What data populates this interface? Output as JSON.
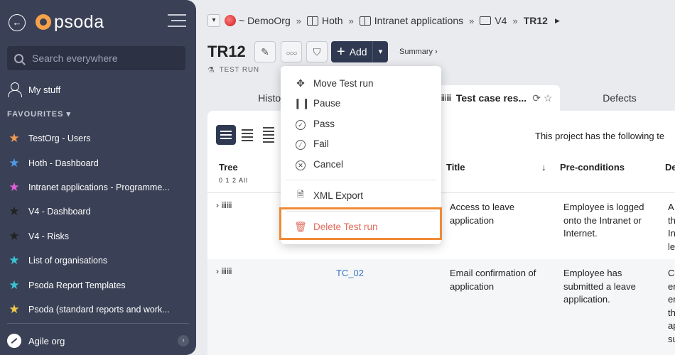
{
  "sidebar": {
    "logo_text": "psoda",
    "search_placeholder": "Search everywhere",
    "my_stuff": "My stuff",
    "favourites_heading": "FAVOURITES",
    "favourites": [
      {
        "label": "TestOrg - Users",
        "color": "#f39a4f"
      },
      {
        "label": "Hoth - Dashboard",
        "color": "#4f9be8"
      },
      {
        "label": "Intranet applications - Programme...",
        "color": "#e35fd7"
      },
      {
        "label": "V4 - Dashboard",
        "color": "#222222"
      },
      {
        "label": "V4 - Risks",
        "color": "#222222"
      },
      {
        "label": "List of organisations",
        "color": "#39c6d4"
      },
      {
        "label": "Psoda Report Templates",
        "color": "#39c6d4"
      },
      {
        "label": "Psoda (standard reports and work...",
        "color": "#f2c94c"
      }
    ],
    "bottom_org": "Agile org"
  },
  "breadcrumb": {
    "org": "~ DemoOrg",
    "items": [
      "Hoth",
      "Intranet applications",
      "V4"
    ],
    "current": "TR12"
  },
  "header": {
    "title": "TR12",
    "add_label": "Add",
    "summary_label": "Summary ›",
    "subtitle": "TEST RUN"
  },
  "tabs": {
    "history": "History",
    "active": "Test case res...",
    "defects": "Defects"
  },
  "panel": {
    "project_text": "This project has the following te",
    "columns": {
      "tree": "Tree",
      "tree_levels": "0 1 2 All",
      "title": "Title",
      "preconditions": "Pre-conditions",
      "description": "De"
    },
    "rows": [
      {
        "id": "",
        "title": "Access to leave application",
        "preconditions": "Employee is logged onto the Intranet or Internet.",
        "desc": "A th In le"
      },
      {
        "id": "TC_02",
        "title": "Email confirmation of application",
        "preconditions": "Employee has submitted a leave application.",
        "desc": "Cl er er th ap su"
      }
    ]
  },
  "dropdown": {
    "items": [
      "Move Test run",
      "Pause",
      "Pass",
      "Fail",
      "Cancel"
    ],
    "export": "XML Export",
    "delete": "Delete Test run"
  },
  "colors": {
    "sidebar_bg": "#3a4156",
    "primary_button": "#2f3a52",
    "delete_text": "#e06a5a",
    "highlight_border": "#f08a35",
    "link": "#3a78c4"
  }
}
